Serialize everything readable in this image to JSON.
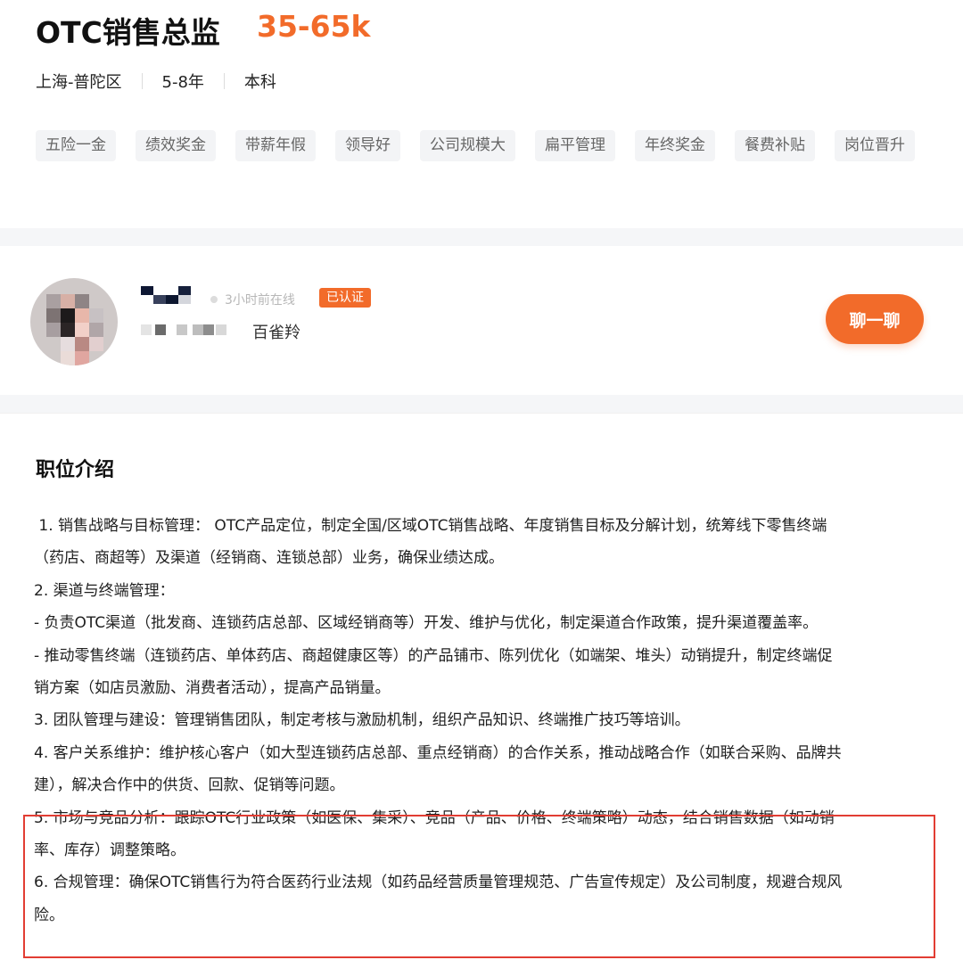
{
  "job": {
    "title": "OTC销售总监",
    "salary": "35-65k",
    "location": "上海-普陀区",
    "experience": "5-8年",
    "education": "本科",
    "tags": [
      "五险一金",
      "绩效奖金",
      "带薪年假",
      "领导好",
      "公司规模大",
      "扁平管理",
      "年终奖金",
      "餐费补贴",
      "岗位晋升"
    ]
  },
  "recruiter": {
    "online_status": "3小时前在线",
    "verified_badge": "已认证",
    "role": "百雀羚",
    "chat_button": "聊一聊"
  },
  "description": {
    "section_title": "职位介绍",
    "lines": [
      " 1. 销售战略与目标管理： OTC产品定位，制定全国/区域OTC销售战略、年度销售目标及分解计划，统筹线下零售终端",
      "（药店、商超等）及渠道（经销商、连锁总部）业务，确保业绩达成。",
      "2. 渠道与终端管理：",
      "- 负责OTC渠道（批发商、连锁药店总部、区域经销商等）开发、维护与优化，制定渠道合作政策，提升渠道覆盖率。",
      "- 推动零售终端（连锁药店、单体药店、商超健康区等）的产品铺市、陈列优化（如端架、堆头）动销提升，制定终端促",
      "销方案（如店员激励、消费者活动），提高产品销量。",
      "3. 团队管理与建设：管理销售团队，制定考核与激励机制，组织产品知识、终端推广技巧等培训。",
      "4. 客户关系维护：维护核心客户（如大型连锁药店总部、重点经销商）的合作关系，推动战略合作（如联合采购、品牌共",
      "建），解决合作中的供货、回款、促销等问题。",
      "5. 市场与竞品分析：跟踪OTC行业政策（如医保、集采）、竞品（产品、价格、终端策略）动态，结合销售数据（如动销",
      "率、库存）调整策略。",
      "6. 合规管理：确保OTC销售行为符合医药行业法规（如药品经营质量管理规范、广告宣传规定）及公司制度，规避合规风",
      "险。"
    ]
  },
  "colors": {
    "accent": "#f26b2a",
    "highlight_border": "#e23d33",
    "tag_bg": "#f3f4f6"
  }
}
